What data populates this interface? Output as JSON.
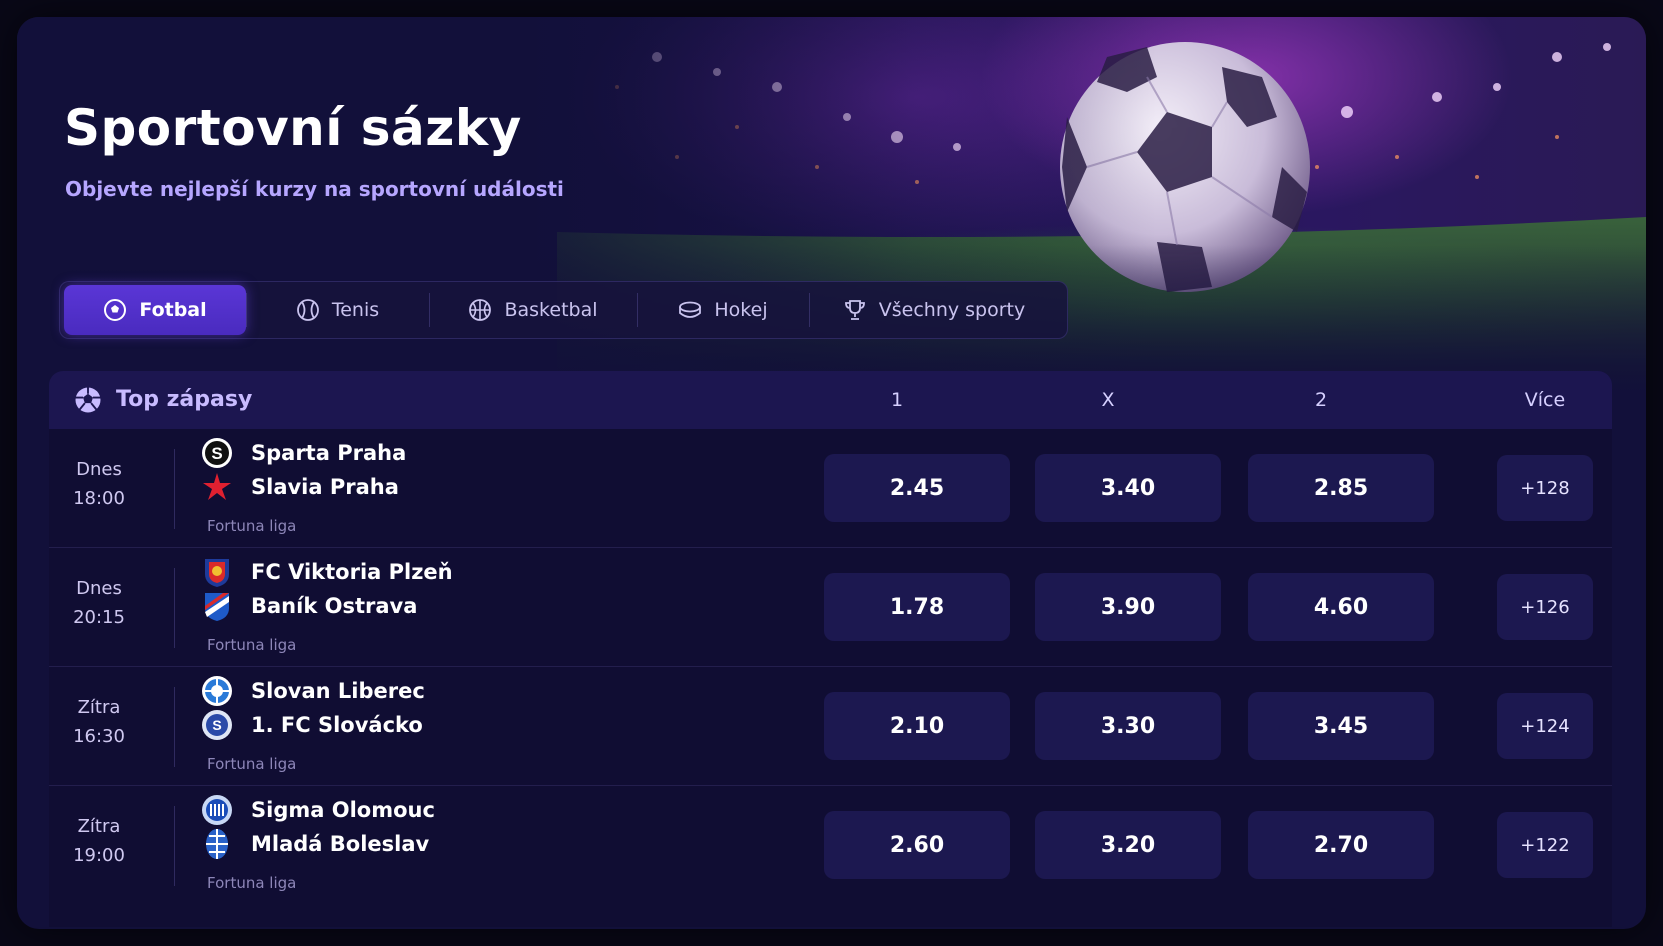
{
  "header": {
    "title": "Sportovní sázky",
    "subtitle": "Objevte nejlepší kurzy na sportovní události"
  },
  "tabs": [
    {
      "label": "Fotbal",
      "icon": "soccer-ball-icon",
      "active": true
    },
    {
      "label": "Tenis",
      "icon": "tennis-ball-icon",
      "active": false
    },
    {
      "label": "Basketbal",
      "icon": "basketball-icon",
      "active": false
    },
    {
      "label": "Hokej",
      "icon": "hockey-puck-icon",
      "active": false
    },
    {
      "label": "Všechny sporty",
      "icon": "trophy-icon",
      "active": false
    }
  ],
  "table": {
    "title": "Top zápasy",
    "columns": {
      "home": "1",
      "draw": "X",
      "away": "2",
      "more": "Více"
    },
    "matches": [
      {
        "day": "Dnes",
        "time": "18:00",
        "home": "Sparta Praha",
        "away": "Slavia Praha",
        "league": "Fortuna liga",
        "odds": [
          "2.45",
          "3.40",
          "2.85"
        ],
        "more": "+128"
      },
      {
        "day": "Dnes",
        "time": "20:15",
        "home": "FC Viktoria Plzeň",
        "away": "Baník Ostrava",
        "league": "Fortuna liga",
        "odds": [
          "1.78",
          "3.90",
          "4.60"
        ],
        "more": "+126"
      },
      {
        "day": "Zítra",
        "time": "16:30",
        "home": "Slovan Liberec",
        "away": "1. FC Slovácko",
        "league": "Fortuna liga",
        "odds": [
          "2.10",
          "3.30",
          "3.45"
        ],
        "more": "+124"
      },
      {
        "day": "Zítra",
        "time": "19:00",
        "home": "Sigma Olomouc",
        "away": "Mladá Boleslav",
        "league": "Fortuna liga",
        "odds": [
          "2.60",
          "3.20",
          "2.70"
        ],
        "more": "+122"
      }
    ]
  },
  "colors": {
    "accent": "#5a36d6",
    "background": "#12103a",
    "subtitle": "#b6a6ff"
  }
}
